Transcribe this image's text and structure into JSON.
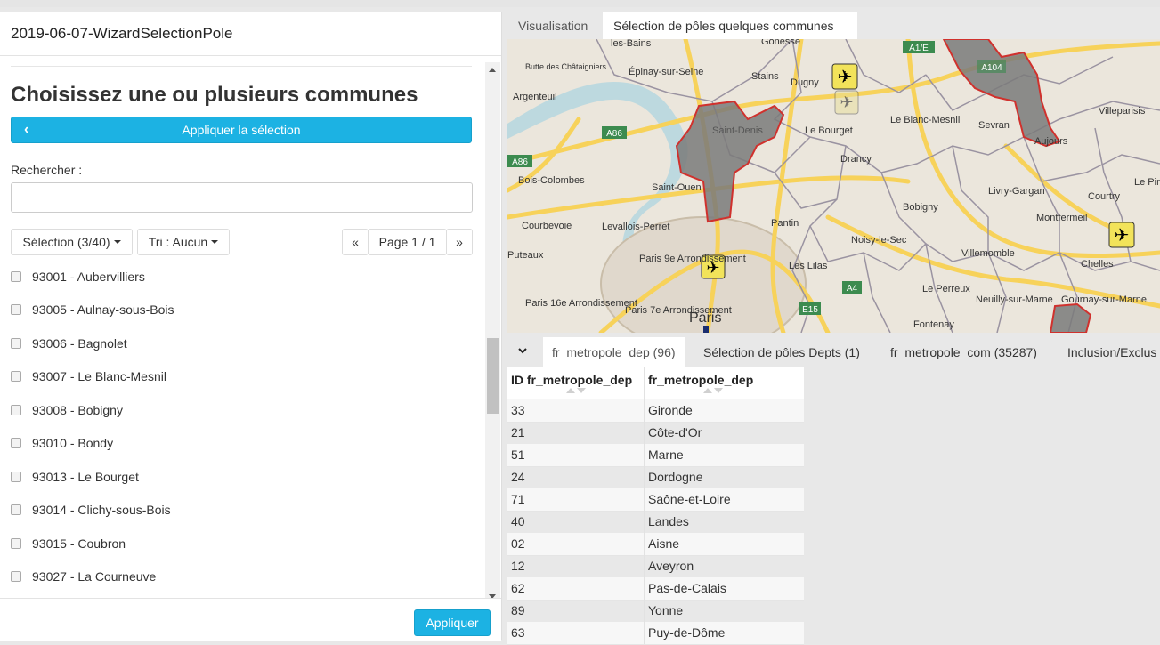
{
  "left": {
    "title": "2019-06-07-WizardSelectionPole",
    "heading": "Choisissez une ou plusieurs communes",
    "apply_selection_label": "Appliquer la sélection",
    "search_label": "Rechercher :",
    "search_value": "",
    "selection_dropdown": "Sélection (3/40)",
    "sort_dropdown": "Tri : Aucun",
    "pager": {
      "prev": "«",
      "page": "Page 1 / 1",
      "next": "»"
    },
    "communes": [
      {
        "label": "93001 - Aubervilliers",
        "checked": false
      },
      {
        "label": "93005 - Aulnay-sous-Bois",
        "checked": false
      },
      {
        "label": "93006 - Bagnolet",
        "checked": false
      },
      {
        "label": "93007 - Le Blanc-Mesnil",
        "checked": false
      },
      {
        "label": "93008 - Bobigny",
        "checked": false
      },
      {
        "label": "93010 - Bondy",
        "checked": false
      },
      {
        "label": "93013 - Le Bourget",
        "checked": false
      },
      {
        "label": "93014 - Clichy-sous-Bois",
        "checked": false
      },
      {
        "label": "93015 - Coubron",
        "checked": false
      },
      {
        "label": "93027 - La Courneuve",
        "checked": false
      }
    ],
    "apply_label": "Appliquer"
  },
  "right": {
    "tabs": [
      "Visualisation",
      "Sélection de pôles quelques communes"
    ],
    "active_tab": 1,
    "map": {
      "labels": [
        "les-Bains",
        "Gonesse",
        "A1/E",
        "Butte des Châtaigniers",
        "Épinay-sur-Seine",
        "Stains",
        "Dugny",
        "A104",
        "Argenteuil",
        "Saint-Denis",
        "Le Blanc-Mesnil",
        "Villeparisis",
        "Sevran",
        "A86",
        "Le Bourget",
        "A86",
        "Aujours",
        "Bois-Colombes",
        "Drancy",
        "Saint-Ouen",
        "Livry-Gargan",
        "Le Pin",
        "Courbevoie",
        "Levallois-Perret",
        "Pantin",
        "Noisy-le-Sec",
        "Montfermeil",
        "Courtry",
        "Bobigny",
        "Villemomble",
        "Paris 9e Arrondissement",
        "Les Lilas",
        "Chelles",
        "Puteaux",
        "Paris 16e Arrondissement",
        "Paris 7e Arrondissement",
        "Paris",
        "Neuilly-sur-Marne",
        "Gournay-sur-Marne",
        "E15",
        "Fontenay",
        "Le Perreux",
        "A4"
      ]
    },
    "bottom_tabs": [
      "fr_metropole_dep (96)",
      "Sélection de pôles Depts (1)",
      "fr_metropole_com (35287)",
      "Inclusion/Exclus"
    ],
    "active_bottom_tab": 0,
    "table": {
      "columns": [
        "ID fr_metropole_dep",
        "fr_metropole_dep"
      ],
      "rows": [
        [
          "33",
          "Gironde"
        ],
        [
          "21",
          "Côte-d'Or"
        ],
        [
          "51",
          "Marne"
        ],
        [
          "24",
          "Dordogne"
        ],
        [
          "71",
          "Saône-et-Loire"
        ],
        [
          "40",
          "Landes"
        ],
        [
          "02",
          "Aisne"
        ],
        [
          "12",
          "Aveyron"
        ],
        [
          "62",
          "Pas-de-Calais"
        ],
        [
          "89",
          "Yonne"
        ],
        [
          "63",
          "Puy-de-Dôme"
        ]
      ]
    }
  },
  "colors": {
    "accent": "#1cb2e3",
    "selected_area": "#7a7a7a",
    "selected_border": "#d0312d",
    "road": "#f7d25a"
  }
}
